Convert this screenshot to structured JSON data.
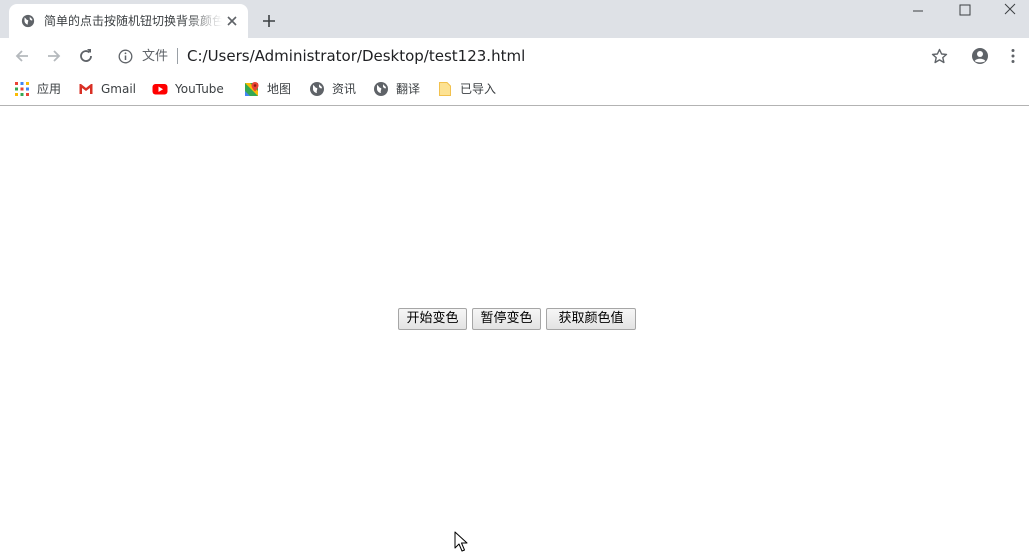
{
  "tab": {
    "title": "简单的点击按随机钮切换背景颜色"
  },
  "toolbar": {
    "scheme_label": "文件",
    "url": "C:/Users/Administrator/Desktop/test123.html"
  },
  "bookmarks": [
    {
      "label": "应用",
      "icon": "apps-grid-icon"
    },
    {
      "label": "Gmail",
      "icon": "gmail-icon"
    },
    {
      "label": "YouTube",
      "icon": "youtube-icon"
    },
    {
      "label": "地图",
      "icon": "maps-icon"
    },
    {
      "label": "资讯",
      "icon": "globe-icon"
    },
    {
      "label": "翻译",
      "icon": "globe-icon"
    },
    {
      "label": "已导入",
      "icon": "folder-icon"
    }
  ],
  "page": {
    "buttons": [
      {
        "label": "开始变色"
      },
      {
        "label": "暂停变色"
      },
      {
        "label": "获取颜色值"
      }
    ]
  },
  "colors": {
    "tabstrip_bg": "#dee1e6",
    "toolbar_bg": "#ffffff",
    "page_bg": "#ffffff",
    "youtube_red": "#ff0000",
    "gmail_red": "#d93025"
  }
}
